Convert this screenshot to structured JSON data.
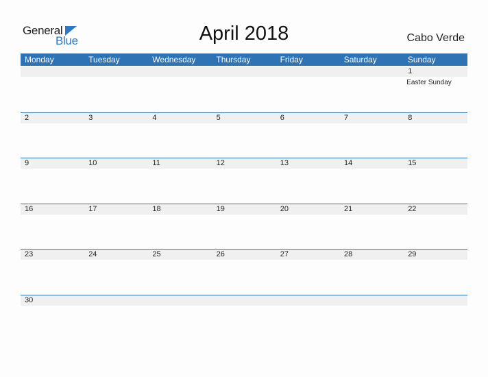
{
  "logo": {
    "general": "General",
    "blue": "Blue"
  },
  "title": "April 2018",
  "country": "Cabo Verde",
  "weekdays": [
    "Monday",
    "Tuesday",
    "Wednesday",
    "Thursday",
    "Friday",
    "Saturday",
    "Sunday"
  ],
  "weeks": [
    [
      "",
      "",
      "",
      "",
      "",
      "",
      {
        "day": "1",
        "event": "Easter Sunday"
      }
    ],
    [
      "2",
      "3",
      "4",
      "5",
      "6",
      "7",
      "8"
    ],
    [
      "9",
      "10",
      "11",
      "12",
      "13",
      "14",
      "15"
    ],
    [
      "16",
      "17",
      "18",
      "19",
      "20",
      "21",
      "22"
    ],
    [
      "23",
      "24",
      "25",
      "26",
      "27",
      "28",
      "29"
    ],
    [
      "30",
      "",
      "",
      "",
      "",
      "",
      ""
    ]
  ],
  "colors": {
    "accent": "#2e73b4",
    "band": "#f0f0f0",
    "logo_blue": "#2e78c8"
  }
}
